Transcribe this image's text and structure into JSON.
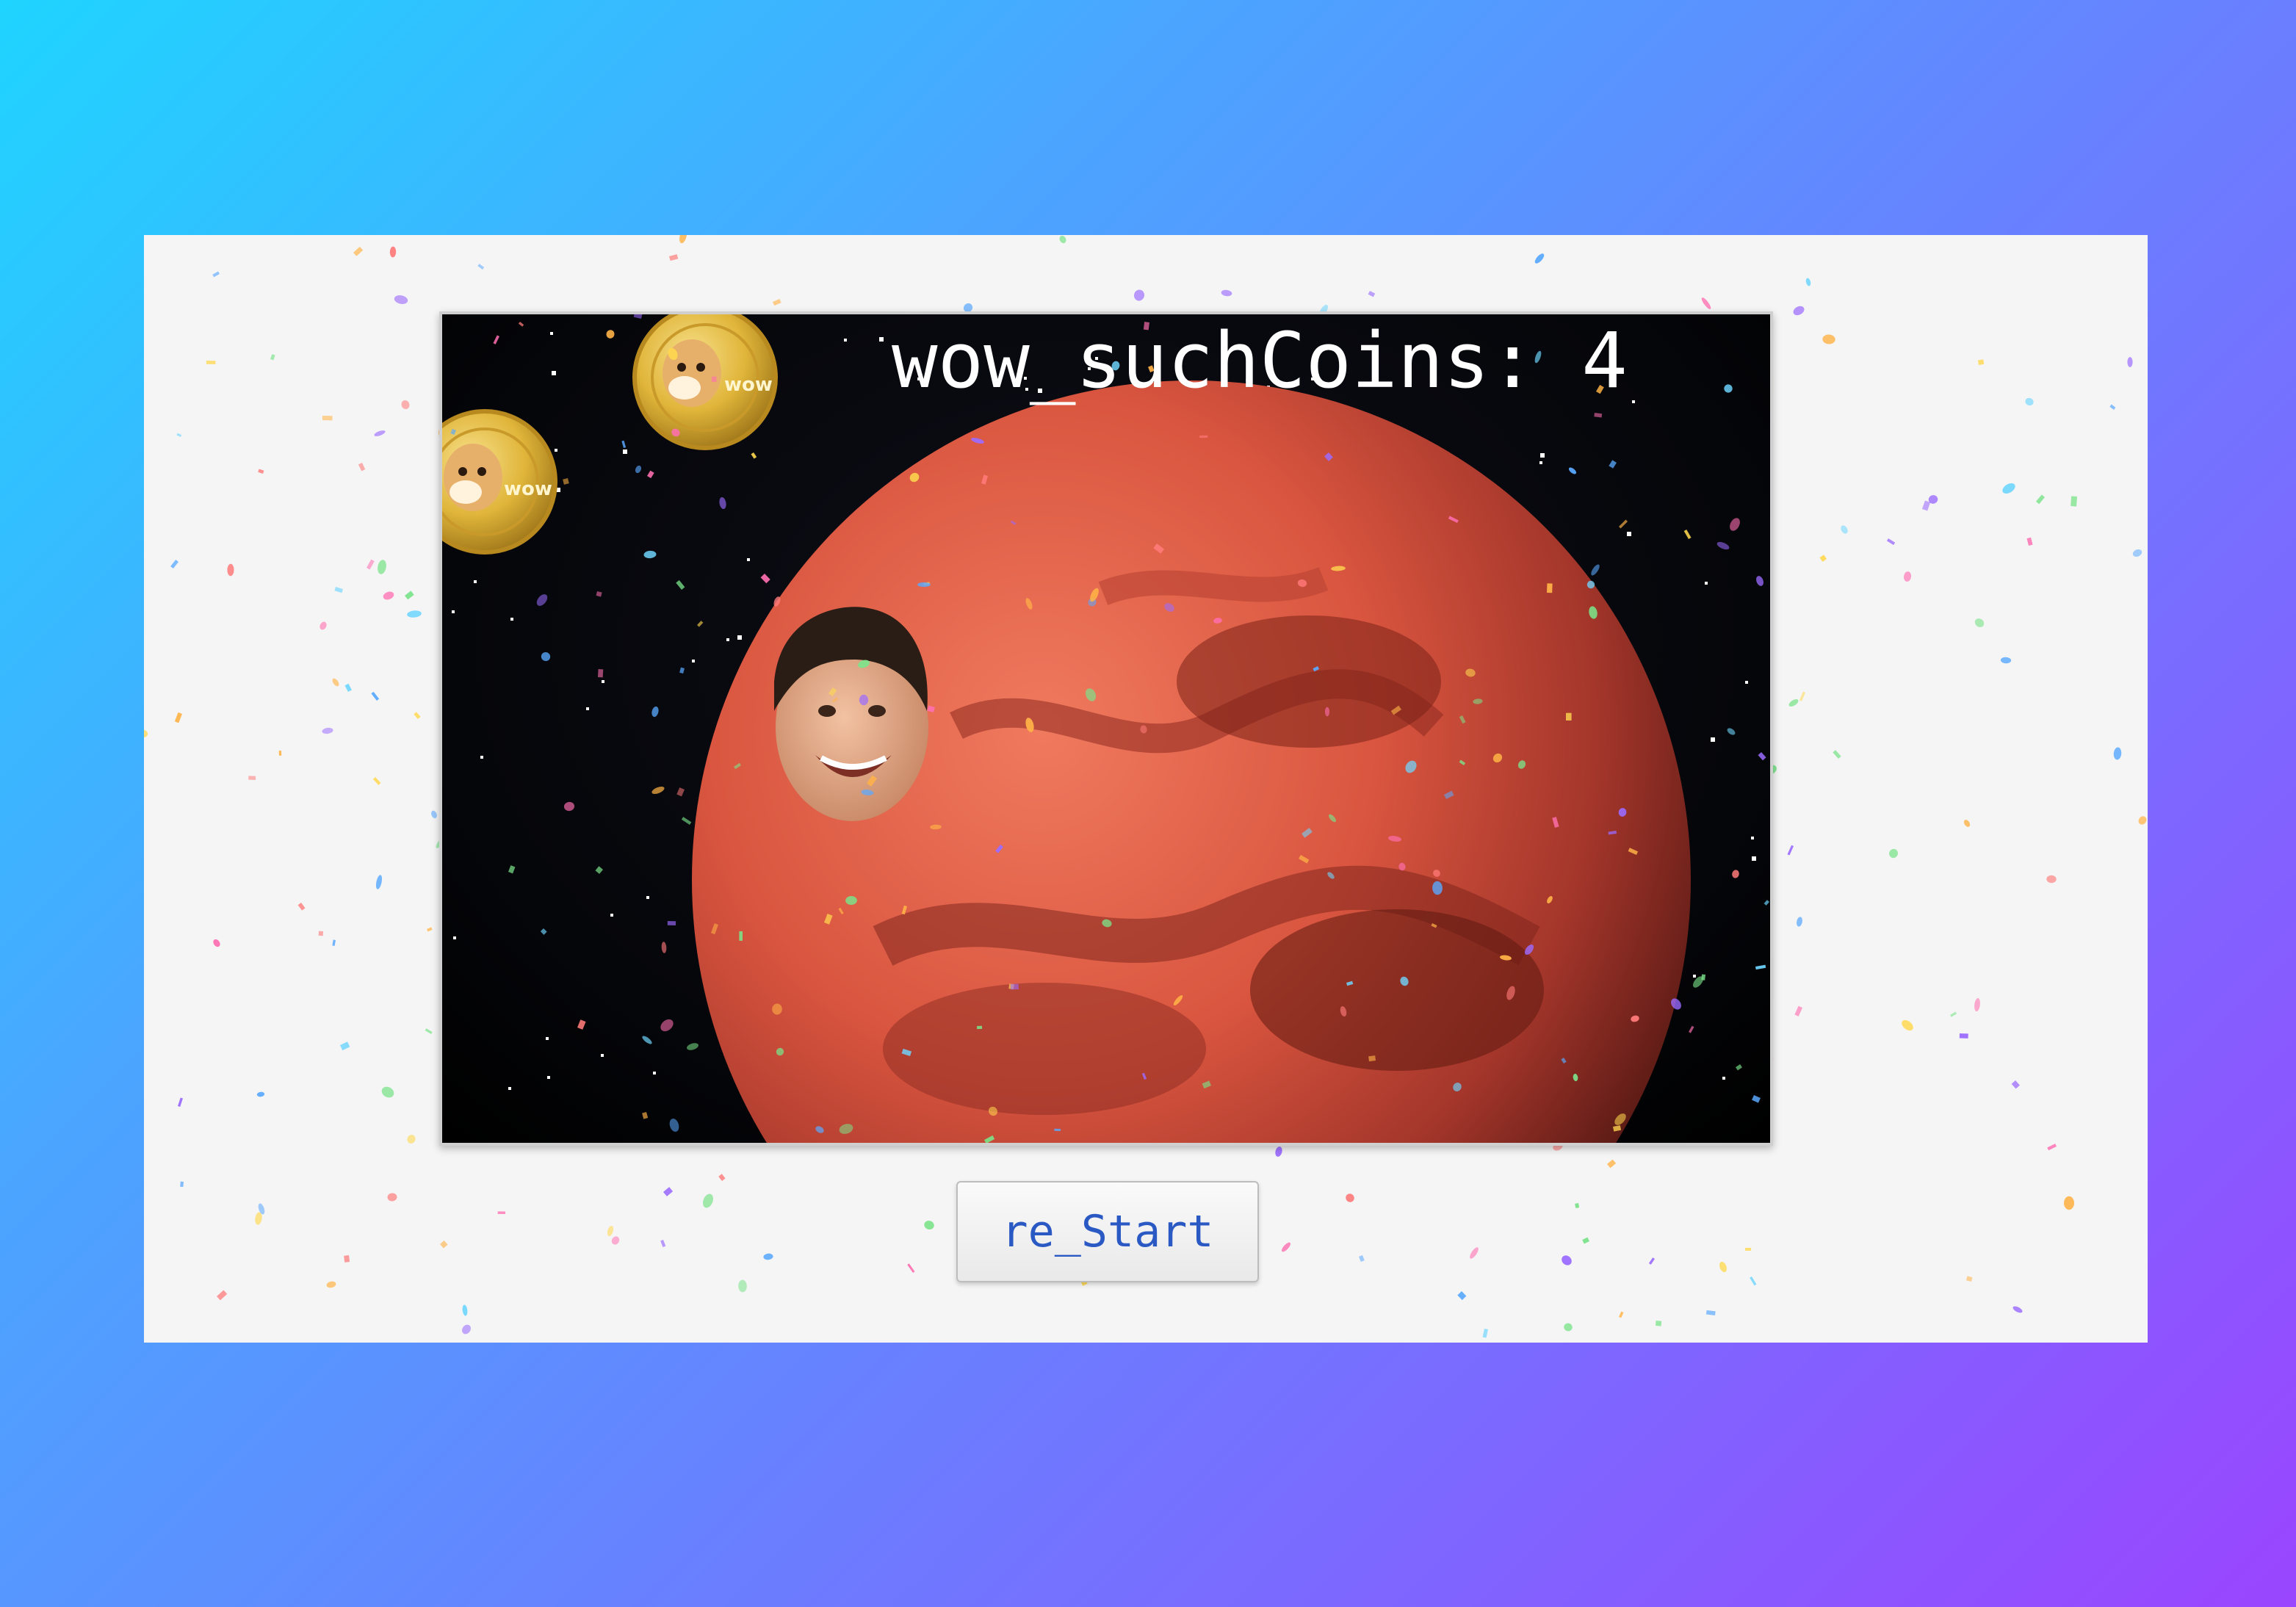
{
  "game": {
    "score_text": "wow_suchCoins: 4",
    "coin_label": "wow",
    "restart_label": "re_Start"
  },
  "colors": {
    "page_gradient": [
      "#1fd4ff",
      "#9a45ff"
    ],
    "panel_bg": "#f5f5f5",
    "space_bg": "#05060a",
    "planet": "#d9553f",
    "coin_gold": "#e0b53a",
    "button_text": "#2a59c4"
  },
  "icons": {
    "coin": "doge-coin-icon",
    "player": "player-face-icon",
    "planet": "mars-planet"
  }
}
